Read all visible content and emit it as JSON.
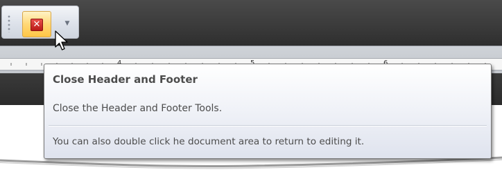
{
  "toolbar": {
    "close_button": {
      "icon": "close-x-icon",
      "glyph": "✕",
      "state": "hover"
    },
    "dropdown": {
      "icon": "chevron-down-icon",
      "glyph": "▼"
    },
    "cursor": {
      "icon": "arrow-cursor-icon"
    }
  },
  "ruler": {
    "numbers": [
      "4",
      "5",
      "6"
    ]
  },
  "tooltip": {
    "title": "Close Header and Footer",
    "description": "Close the Header and Footer Tools.",
    "note": "You can also double click he document area to return to editing it."
  },
  "colors": {
    "app_dark": "#3a3a3a",
    "button_hover": "#ffd877",
    "close_red": "#c62a26",
    "tooltip_text": "#4c4c4c"
  }
}
